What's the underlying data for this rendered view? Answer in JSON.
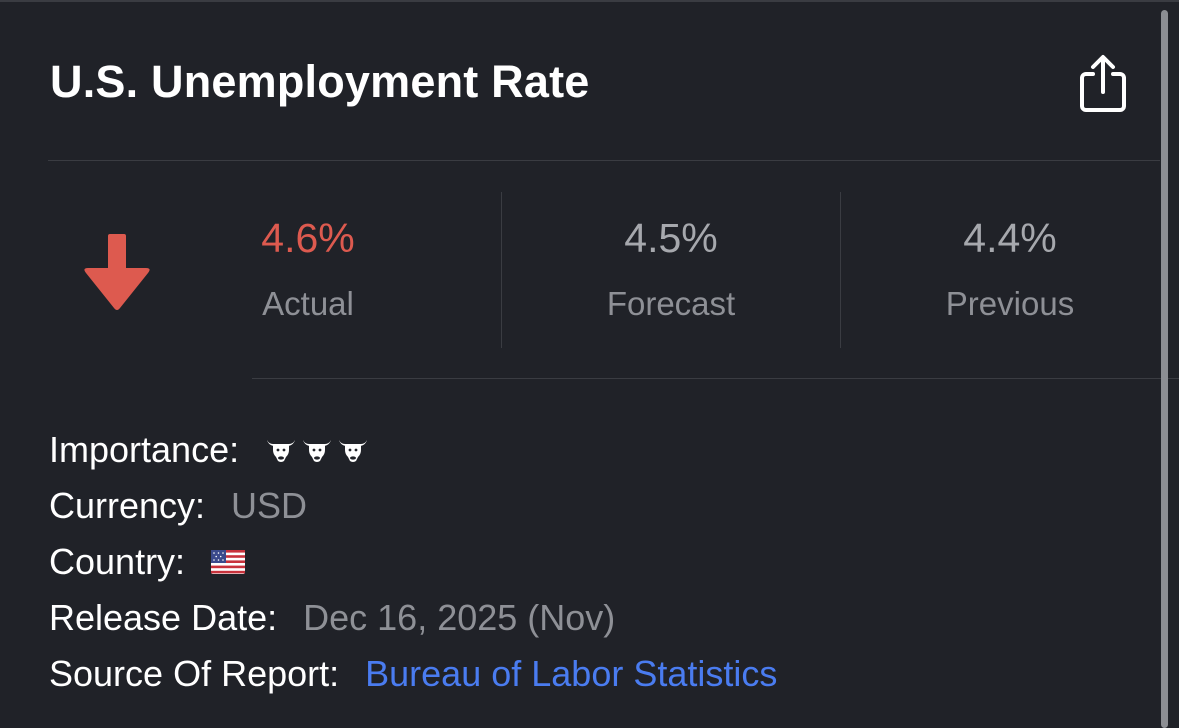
{
  "header": {
    "title": "U.S. Unemployment Rate",
    "share_icon": "share-icon"
  },
  "stats": {
    "direction_icon": "arrow-down-icon",
    "direction_color": "#dd5a4f",
    "actual": {
      "value": "4.6%",
      "label": "Actual"
    },
    "forecast": {
      "value": "4.5%",
      "label": "Forecast"
    },
    "previous": {
      "value": "4.4%",
      "label": "Previous"
    }
  },
  "details": {
    "importance": {
      "label": "Importance:",
      "level": 3,
      "icon": "bull-icon"
    },
    "currency": {
      "label": "Currency:",
      "value": "USD"
    },
    "country": {
      "label": "Country:",
      "icon": "us-flag-icon"
    },
    "release_date": {
      "label": "Release Date:",
      "value": "Dec 16, 2025 (Nov)"
    },
    "source": {
      "label": "Source Of Report:",
      "value": "Bureau of Labor Statistics"
    }
  },
  "colors": {
    "background": "#202228",
    "actual_value": "#dd5a4f",
    "link": "#4a7cf0",
    "muted": "#8e9096"
  }
}
